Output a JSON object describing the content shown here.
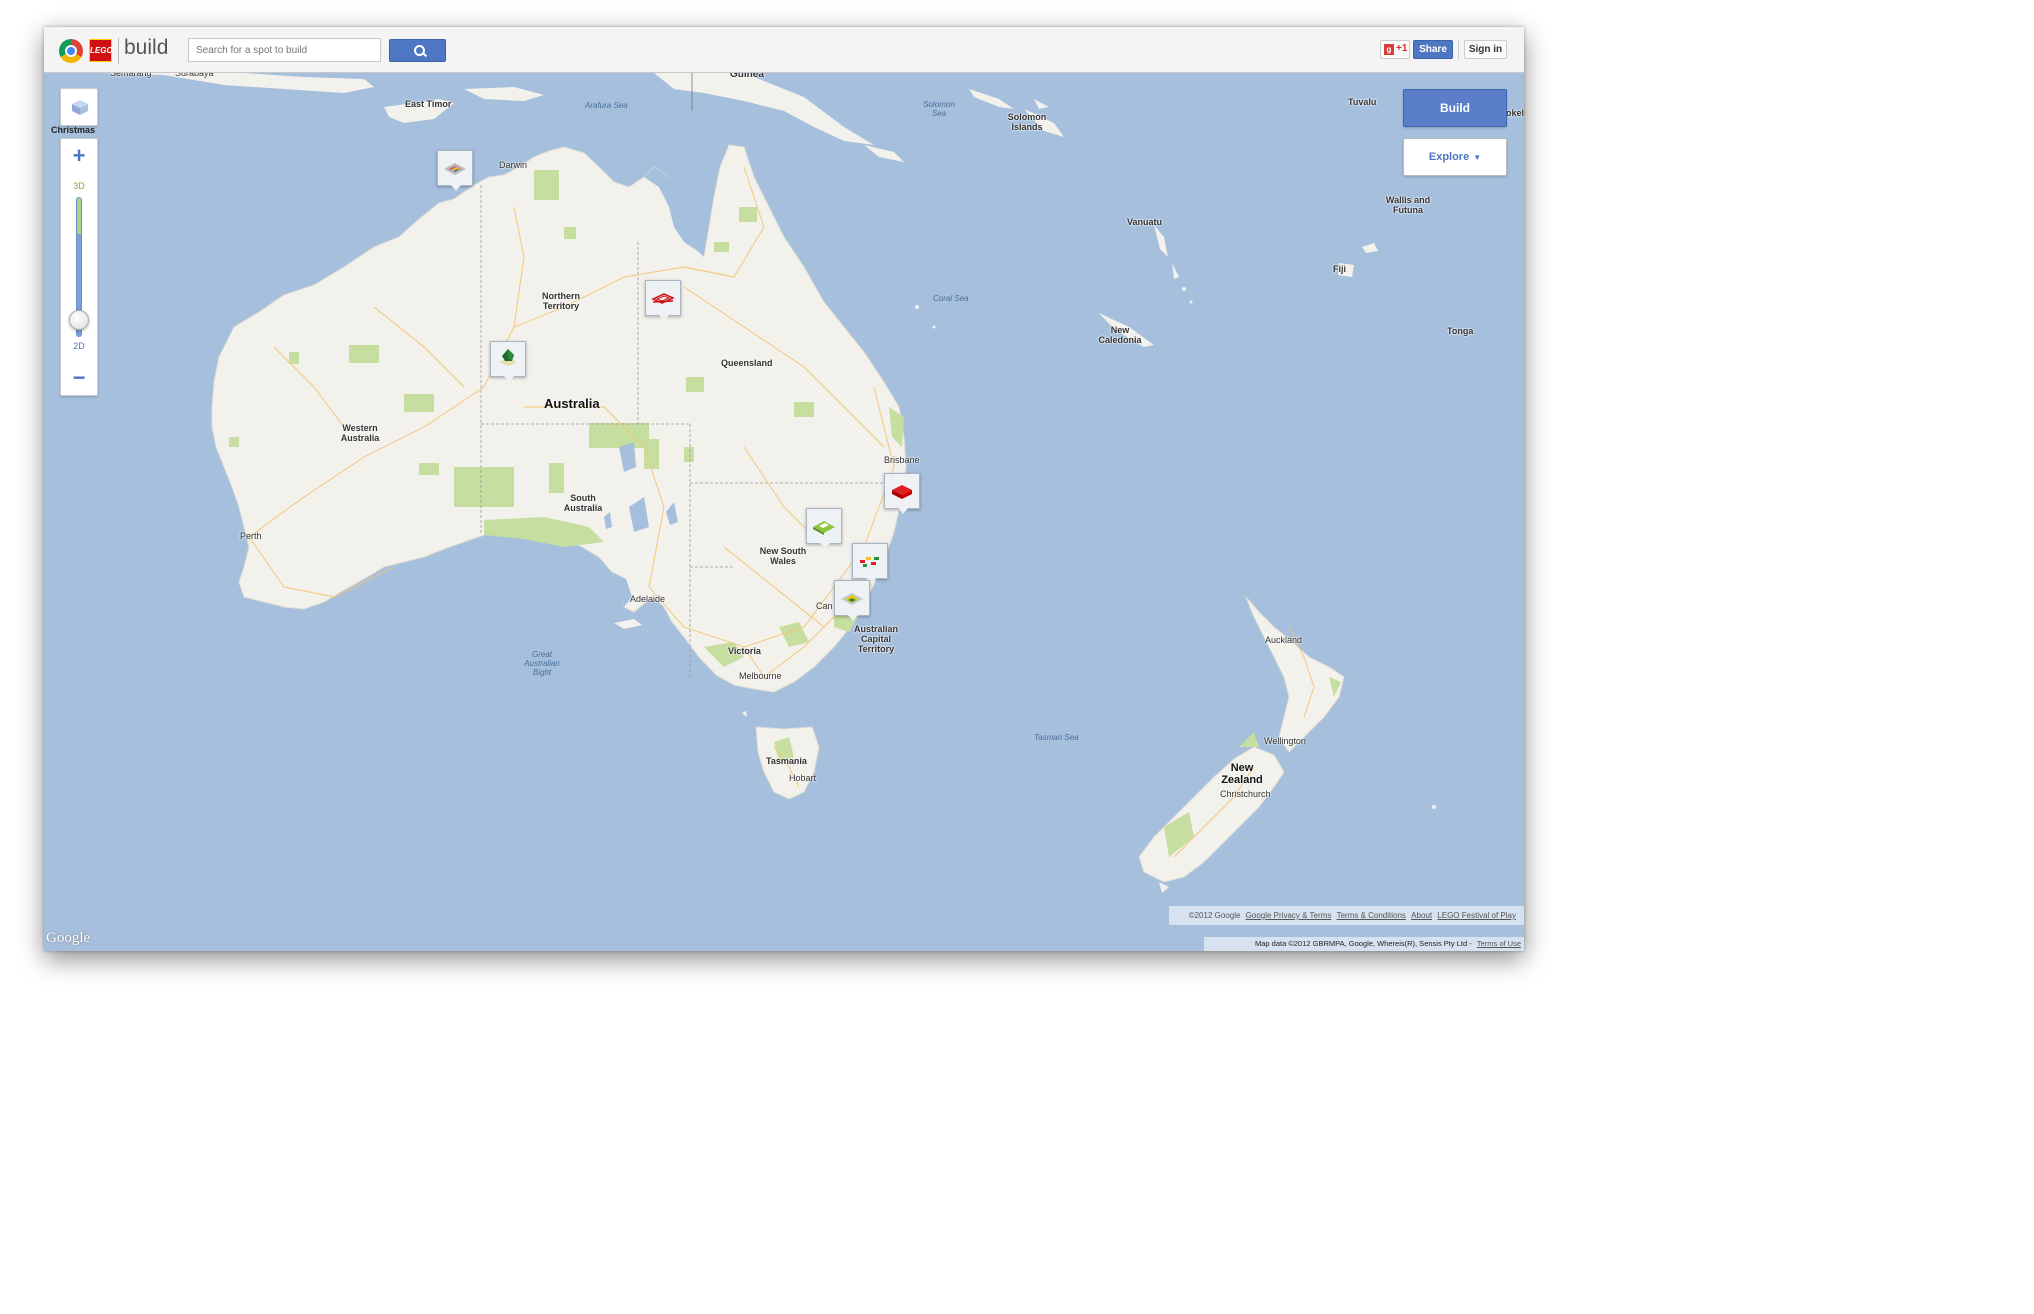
{
  "header": {
    "app_name": "build",
    "lego_text": "LEGO",
    "search_placeholder": "Search for a spot to build",
    "gplus_label": "+1",
    "share_label": "Share",
    "signin_label": "Sign in"
  },
  "controls": {
    "christmas_label": "Christmas",
    "zoom_in": "+",
    "zoom_out": "−",
    "mode_3d": "3D",
    "mode_2d": "2D",
    "zoom_level": 0.88,
    "build_label": "Build",
    "explore_label": "Explore",
    "explore_chevron": "▼"
  },
  "labels": {
    "semarang": "Semarang",
    "surabaya": "Surabaya",
    "guinea": "Guinea",
    "east_timor": "East Timor",
    "arafura_sea": "Arafura Sea",
    "solomon_sea_1": "Solomon",
    "solomon_sea_2": "Sea",
    "solomon_islands_1": "Solomon",
    "solomon_islands_2": "Islands",
    "tuvalu": "Tuvalu",
    "tokelau": "okel",
    "darwin": "Darwin",
    "northern_territory_1": "Northern",
    "northern_territory_2": "Territory",
    "vanuatu": "Vanuatu",
    "wallis_1": "Wallis and",
    "wallis_2": "Futuna",
    "fiji": "Fiji",
    "coral_sea": "Coral Sea",
    "new_caledonia_1": "New",
    "new_caledonia_2": "Caledonia",
    "tonga": "Tonga",
    "queensland": "Queensland",
    "australia": "Australia",
    "western_australia_1": "Western",
    "western_australia_2": "Australia",
    "brisbane": "Brisbane",
    "south_australia_1": "South",
    "south_australia_2": "Australia",
    "perth": "Perth",
    "nsw_1": "New South",
    "nsw_2": "Wales",
    "adelaide": "Adelaide",
    "canberra": "Can",
    "act_1": "Australian",
    "act_2": "Capital",
    "act_3": "Territory",
    "gab_1": "Great",
    "gab_2": "Australian",
    "gab_3": "Bight",
    "victoria": "Victoria",
    "melbourne": "Melbourne",
    "auckland": "Auckland",
    "tasman_sea": "Tasman Sea",
    "wellington": "Wellington",
    "tasmania": "Tasmania",
    "hobart": "Hobart",
    "new_zealand_1": "New",
    "new_zealand_2": "Zealand",
    "christchurch": "Christchurch"
  },
  "markers": [
    {
      "name": "marker-kimberley",
      "icon": "striped-plate-build"
    },
    {
      "name": "marker-gulf",
      "icon": "red-outline-build"
    },
    {
      "name": "marker-central",
      "icon": "green-tree-build"
    },
    {
      "name": "marker-brisbane",
      "icon": "red-brick-build"
    },
    {
      "name": "marker-nsw-1",
      "icon": "green-plate-build"
    },
    {
      "name": "marker-nsw-2",
      "icon": "flowers-build"
    },
    {
      "name": "marker-canberra",
      "icon": "yellow-plate-build"
    }
  ],
  "footer": {
    "copyright": "©2012 Google",
    "privacy": "Google Privacy & Terms",
    "terms": "Terms & Conditions",
    "about": "About",
    "festival": "LEGO Festival of Play",
    "map_data": "Map data ©2012 GBRMPA, Google, Whereis(R), Sensis Pty Ltd -",
    "terms_of_use": "Terms of Use",
    "google_logo": "Google"
  },
  "colors": {
    "ocean": "#a5bfdd",
    "land": "#f3f1ec",
    "park": "#c6dea0",
    "accent": "#4d77c3"
  }
}
